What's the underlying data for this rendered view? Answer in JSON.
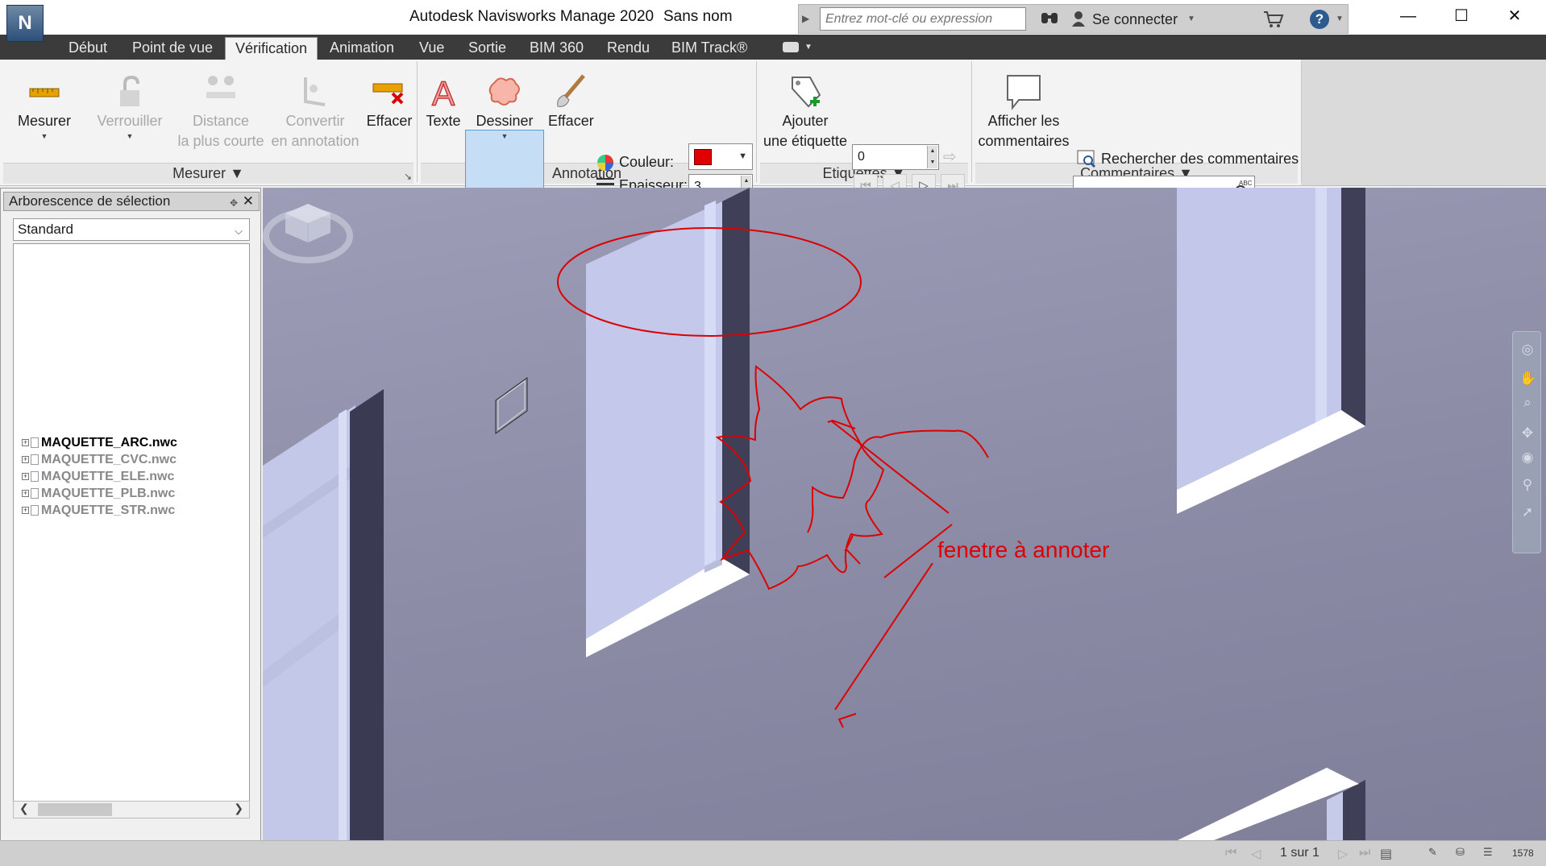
{
  "title_bar": {
    "app_logo": "N",
    "app_title": "Autodesk Navisworks Manage 2020",
    "document_name": "Sans nom",
    "search_placeholder": "Entrez mot-clé ou expression",
    "sign_in": "Se connecter",
    "help": "?",
    "window_buttons": {
      "minimize": "—",
      "maximize": "☐",
      "close": "✕"
    }
  },
  "menu_tabs": [
    "Début",
    "Point de vue",
    "Vérification",
    "Animation",
    "Vue",
    "Sortie",
    "BIM 360",
    "Rendu",
    "BIM Track®"
  ],
  "active_tab": "Vérification",
  "ribbon": {
    "mesurer_panel": {
      "title": "Mesurer",
      "measure": "Mesurer",
      "lock": "Verrouiller",
      "shortest_line1": "Distance",
      "shortest_line2": "la plus courte",
      "convert_line1": "Convertir",
      "convert_line2": "en annotation",
      "clear": "Effacer"
    },
    "annotation_panel": {
      "title": "Annotation",
      "text": "Texte",
      "draw": "Dessiner",
      "erase": "Effacer",
      "color_label": "Couleur:",
      "color_value": "#e00000",
      "thickness_label": "Epaisseur:",
      "thickness_value": "3"
    },
    "tags_panel": {
      "title": "Etiquettes",
      "add_line1": "Ajouter",
      "add_line2": "une étiquette",
      "tag_id": "0"
    },
    "comments_panel": {
      "title": "Commentaires",
      "show_line1": "Afficher les",
      "show_line2": "commentaires",
      "find": "Rechercher des commentaires"
    }
  },
  "selection_tree": {
    "title": "Arborescence de sélection",
    "mode": "Standard",
    "items": [
      {
        "name": "MAQUETTE_ARC.nwc",
        "hidden": false
      },
      {
        "name": "MAQUETTE_CVC.nwc",
        "hidden": true
      },
      {
        "name": "MAQUETTE_ELE.nwc",
        "hidden": true
      },
      {
        "name": "MAQUETTE_PLB.nwc",
        "hidden": true
      },
      {
        "name": "MAQUETTE_STR.nwc",
        "hidden": true
      }
    ]
  },
  "viewport": {
    "annotation_text": "fenetre à annoter",
    "annotation_color": "#dd0000"
  },
  "status_bar": {
    "page": "1 sur 1",
    "memory": "1578"
  }
}
